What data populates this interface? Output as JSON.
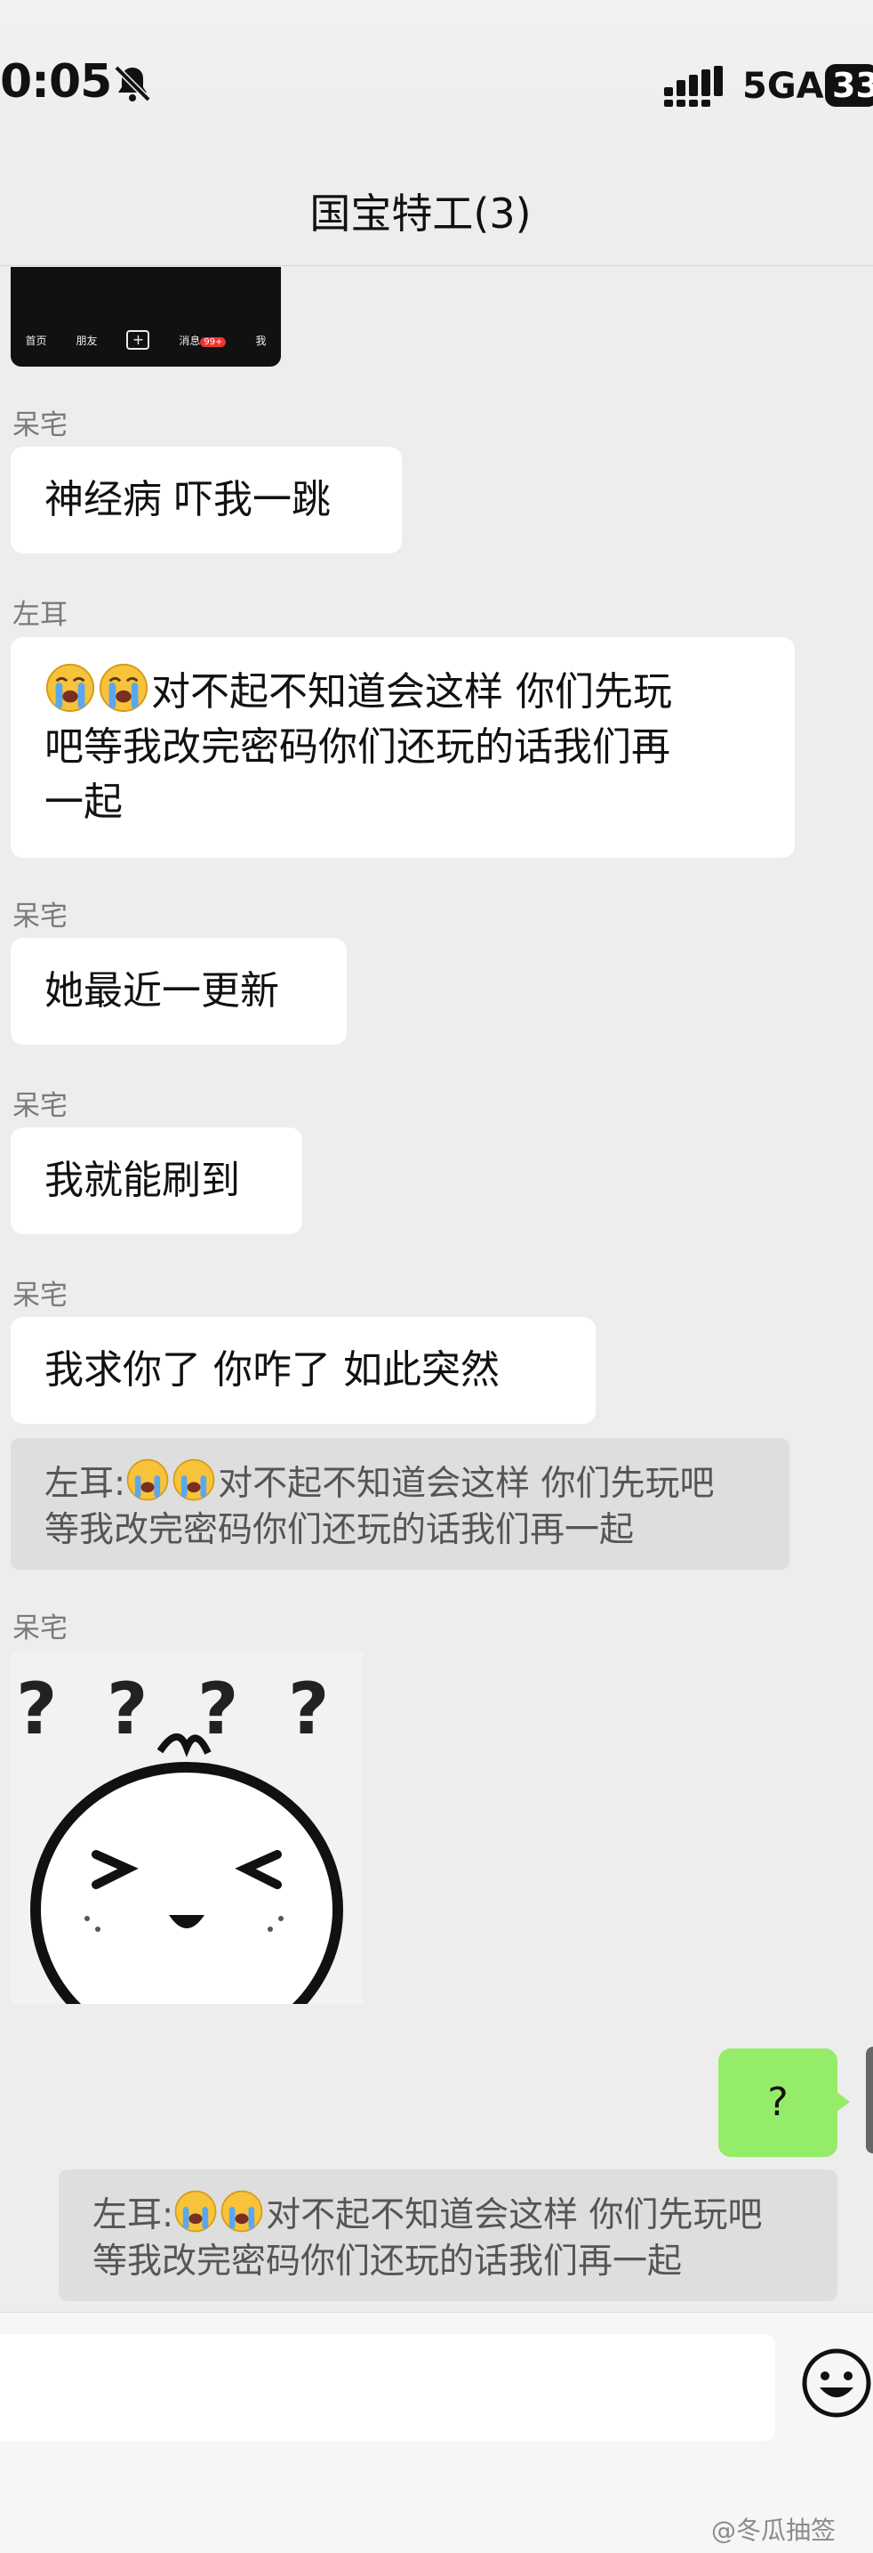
{
  "status": {
    "time": "0:05",
    "network": "5GA",
    "battery": "33"
  },
  "nav": {
    "title": "国宝特工(3)"
  },
  "thumbnail": {
    "tabs": [
      "首页",
      "朋友",
      "+",
      "消息",
      "我"
    ],
    "badge": "99+"
  },
  "messages": [
    {
      "sender": "呆宅",
      "text": "神经病 吓我一跳"
    },
    {
      "sender": "左耳",
      "text_line1": "对不起不知道会这样 你们先玩",
      "text_line2": "吧等我改完密码你们还玩的话我们再",
      "text_line3": "一起",
      "emoji": "loudly-crying-face"
    },
    {
      "sender": "呆宅",
      "text": "她最近一更新"
    },
    {
      "sender": "呆宅",
      "text": "我就能刷到"
    },
    {
      "sender": "呆宅",
      "text": "我求你了 你咋了 如此突然"
    },
    {
      "sender": "呆宅",
      "sticker": "confused-face-sticker"
    }
  ],
  "quote_1": {
    "prefix": "左耳:",
    "line1": "对不起不知道会这样 你们先玩吧",
    "line2": "等我改完密码你们还玩的话我们再一起"
  },
  "my_message": {
    "text": "?"
  },
  "quote_2": {
    "prefix": "左耳:",
    "line1": "对不起不知道会这样 你们先玩吧",
    "line2": "等我改完密码你们还玩的话我们再一起"
  },
  "watermark": "@冬瓜抽签",
  "colors": {
    "background": "#ededed",
    "my_bubble": "#95ec69",
    "their_bubble": "#ffffff",
    "quote": "#dedede"
  }
}
